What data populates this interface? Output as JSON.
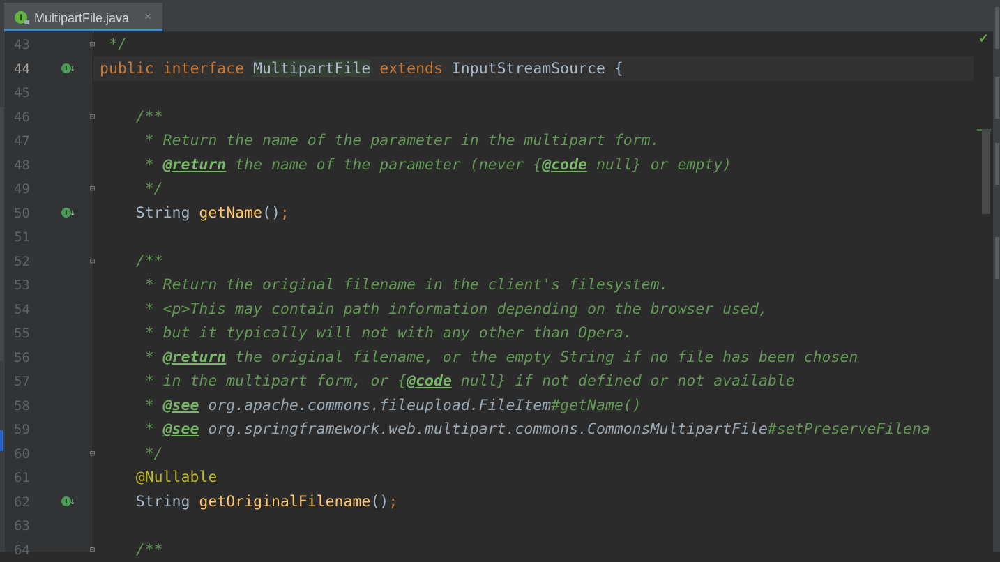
{
  "tab": {
    "filename": "MultipartFile.java",
    "icon": "I",
    "close": "×"
  },
  "status": {
    "check": "✓"
  },
  "lines": [
    {
      "n": "43",
      "segs": [
        {
          "t": " */",
          "c": "cm"
        }
      ]
    },
    {
      "n": "44",
      "segs": [
        {
          "t": "public ",
          "c": "kw"
        },
        {
          "t": "interface ",
          "c": "kw"
        },
        {
          "t": "",
          "c": "caret"
        },
        {
          "t": "MultipartFile",
          "c": "hl"
        },
        {
          "t": " extends ",
          "c": "kw"
        },
        {
          "t": "InputStreamSource {",
          "c": ""
        }
      ]
    },
    {
      "n": "45",
      "segs": []
    },
    {
      "n": "46",
      "segs": [
        {
          "t": "    /**",
          "c": "cm"
        }
      ]
    },
    {
      "n": "47",
      "segs": [
        {
          "t": "     * Return the name of the parameter in the multipart form.",
          "c": "cm"
        }
      ]
    },
    {
      "n": "48",
      "segs": [
        {
          "t": "     * ",
          "c": "cm"
        },
        {
          "t": "@return",
          "c": "tag"
        },
        {
          "t": " the name of the parameter (never {",
          "c": "cm"
        },
        {
          "t": "@code",
          "c": "tag"
        },
        {
          "t": " null} or empty)",
          "c": "cm"
        }
      ]
    },
    {
      "n": "49",
      "segs": [
        {
          "t": "     */",
          "c": "cm"
        }
      ]
    },
    {
      "n": "50",
      "segs": [
        {
          "t": "    String ",
          "c": ""
        },
        {
          "t": "getName",
          "c": "fn"
        },
        {
          "t": "()",
          "c": ""
        },
        {
          "t": ";",
          "c": "kw"
        }
      ]
    },
    {
      "n": "51",
      "segs": []
    },
    {
      "n": "52",
      "segs": [
        {
          "t": "    /**",
          "c": "cm"
        }
      ]
    },
    {
      "n": "53",
      "segs": [
        {
          "t": "     * Return the original filename in the client's filesystem.",
          "c": "cm"
        }
      ]
    },
    {
      "n": "54",
      "segs": [
        {
          "t": "     * <p>This may contain path information depending on the browser used,",
          "c": "cm"
        }
      ]
    },
    {
      "n": "55",
      "segs": [
        {
          "t": "     * but it typically will not with any other than Opera.",
          "c": "cm"
        }
      ]
    },
    {
      "n": "56",
      "segs": [
        {
          "t": "     * ",
          "c": "cm"
        },
        {
          "t": "@return",
          "c": "tag"
        },
        {
          "t": " the original filename, or the empty String if no file has been chosen",
          "c": "cm"
        }
      ]
    },
    {
      "n": "57",
      "segs": [
        {
          "t": "     * in the multipart form, or {",
          "c": "cm"
        },
        {
          "t": "@code",
          "c": "tag"
        },
        {
          "t": " null} if not defined or not available",
          "c": "cm"
        }
      ]
    },
    {
      "n": "58",
      "segs": [
        {
          "t": "     * ",
          "c": "cm"
        },
        {
          "t": "@see",
          "c": "tag"
        },
        {
          "t": " org.apache.commons.fileupload.FileItem",
          "c": "ref"
        },
        {
          "t": "#getName()",
          "c": "cm"
        }
      ]
    },
    {
      "n": "59",
      "segs": [
        {
          "t": "     * ",
          "c": "cm"
        },
        {
          "t": "@see",
          "c": "tag"
        },
        {
          "t": " org.springframework.web.multipart.commons.CommonsMultipartFile",
          "c": "ref"
        },
        {
          "t": "#setPreserveFilena",
          "c": "cm"
        }
      ]
    },
    {
      "n": "60",
      "segs": [
        {
          "t": "     */",
          "c": "cm"
        }
      ]
    },
    {
      "n": "61",
      "segs": [
        {
          "t": "    @Nullable",
          "c": "an"
        }
      ]
    },
    {
      "n": "62",
      "segs": [
        {
          "t": "    String ",
          "c": ""
        },
        {
          "t": "getOriginalFilename",
          "c": "fn"
        },
        {
          "t": "()",
          "c": ""
        },
        {
          "t": ";",
          "c": "kw"
        }
      ]
    },
    {
      "n": "63",
      "segs": []
    },
    {
      "n": "64",
      "segs": [
        {
          "t": "    /**",
          "c": "cm"
        }
      ]
    }
  ],
  "current_line": "44",
  "fold_lines": [
    "43",
    "46",
    "49",
    "52",
    "60",
    "64"
  ],
  "impl_lines": [
    "44",
    "50",
    "62"
  ],
  "icons": {
    "fold": "fold-marker-icon",
    "impl": "implemented-method-icon"
  },
  "colors": {
    "keyword": "#cc7832",
    "comment": "#629755",
    "method": "#ffc66d",
    "annotation": "#bbb529",
    "text": "#a9b7c6",
    "background": "#2b2b2b"
  }
}
